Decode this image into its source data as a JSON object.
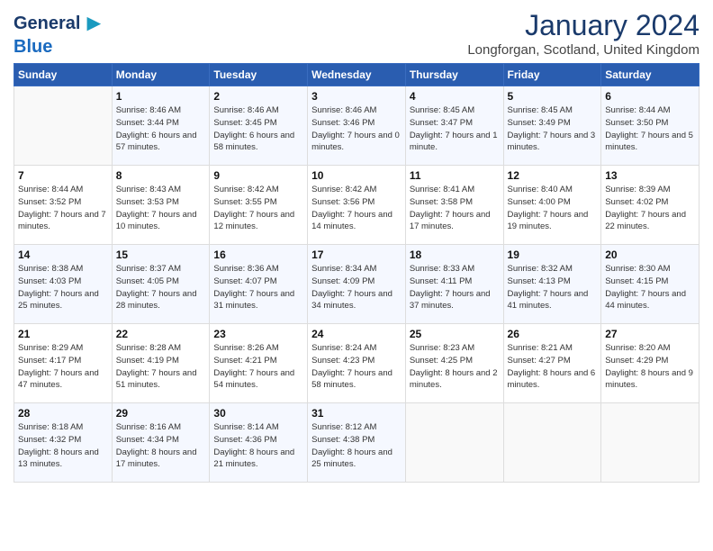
{
  "header": {
    "logo_line1": "General",
    "logo_line2": "Blue",
    "month": "January 2024",
    "location": "Longforgan, Scotland, United Kingdom"
  },
  "days_of_week": [
    "Sunday",
    "Monday",
    "Tuesday",
    "Wednesday",
    "Thursday",
    "Friday",
    "Saturday"
  ],
  "weeks": [
    [
      {
        "day": "",
        "sunrise": "",
        "sunset": "",
        "daylight": ""
      },
      {
        "day": "1",
        "sunrise": "Sunrise: 8:46 AM",
        "sunset": "Sunset: 3:44 PM",
        "daylight": "Daylight: 6 hours and 57 minutes."
      },
      {
        "day": "2",
        "sunrise": "Sunrise: 8:46 AM",
        "sunset": "Sunset: 3:45 PM",
        "daylight": "Daylight: 6 hours and 58 minutes."
      },
      {
        "day": "3",
        "sunrise": "Sunrise: 8:46 AM",
        "sunset": "Sunset: 3:46 PM",
        "daylight": "Daylight: 7 hours and 0 minutes."
      },
      {
        "day": "4",
        "sunrise": "Sunrise: 8:45 AM",
        "sunset": "Sunset: 3:47 PM",
        "daylight": "Daylight: 7 hours and 1 minute."
      },
      {
        "day": "5",
        "sunrise": "Sunrise: 8:45 AM",
        "sunset": "Sunset: 3:49 PM",
        "daylight": "Daylight: 7 hours and 3 minutes."
      },
      {
        "day": "6",
        "sunrise": "Sunrise: 8:44 AM",
        "sunset": "Sunset: 3:50 PM",
        "daylight": "Daylight: 7 hours and 5 minutes."
      }
    ],
    [
      {
        "day": "7",
        "sunrise": "Sunrise: 8:44 AM",
        "sunset": "Sunset: 3:52 PM",
        "daylight": "Daylight: 7 hours and 7 minutes."
      },
      {
        "day": "8",
        "sunrise": "Sunrise: 8:43 AM",
        "sunset": "Sunset: 3:53 PM",
        "daylight": "Daylight: 7 hours and 10 minutes."
      },
      {
        "day": "9",
        "sunrise": "Sunrise: 8:42 AM",
        "sunset": "Sunset: 3:55 PM",
        "daylight": "Daylight: 7 hours and 12 minutes."
      },
      {
        "day": "10",
        "sunrise": "Sunrise: 8:42 AM",
        "sunset": "Sunset: 3:56 PM",
        "daylight": "Daylight: 7 hours and 14 minutes."
      },
      {
        "day": "11",
        "sunrise": "Sunrise: 8:41 AM",
        "sunset": "Sunset: 3:58 PM",
        "daylight": "Daylight: 7 hours and 17 minutes."
      },
      {
        "day": "12",
        "sunrise": "Sunrise: 8:40 AM",
        "sunset": "Sunset: 4:00 PM",
        "daylight": "Daylight: 7 hours and 19 minutes."
      },
      {
        "day": "13",
        "sunrise": "Sunrise: 8:39 AM",
        "sunset": "Sunset: 4:02 PM",
        "daylight": "Daylight: 7 hours and 22 minutes."
      }
    ],
    [
      {
        "day": "14",
        "sunrise": "Sunrise: 8:38 AM",
        "sunset": "Sunset: 4:03 PM",
        "daylight": "Daylight: 7 hours and 25 minutes."
      },
      {
        "day": "15",
        "sunrise": "Sunrise: 8:37 AM",
        "sunset": "Sunset: 4:05 PM",
        "daylight": "Daylight: 7 hours and 28 minutes."
      },
      {
        "day": "16",
        "sunrise": "Sunrise: 8:36 AM",
        "sunset": "Sunset: 4:07 PM",
        "daylight": "Daylight: 7 hours and 31 minutes."
      },
      {
        "day": "17",
        "sunrise": "Sunrise: 8:34 AM",
        "sunset": "Sunset: 4:09 PM",
        "daylight": "Daylight: 7 hours and 34 minutes."
      },
      {
        "day": "18",
        "sunrise": "Sunrise: 8:33 AM",
        "sunset": "Sunset: 4:11 PM",
        "daylight": "Daylight: 7 hours and 37 minutes."
      },
      {
        "day": "19",
        "sunrise": "Sunrise: 8:32 AM",
        "sunset": "Sunset: 4:13 PM",
        "daylight": "Daylight: 7 hours and 41 minutes."
      },
      {
        "day": "20",
        "sunrise": "Sunrise: 8:30 AM",
        "sunset": "Sunset: 4:15 PM",
        "daylight": "Daylight: 7 hours and 44 minutes."
      }
    ],
    [
      {
        "day": "21",
        "sunrise": "Sunrise: 8:29 AM",
        "sunset": "Sunset: 4:17 PM",
        "daylight": "Daylight: 7 hours and 47 minutes."
      },
      {
        "day": "22",
        "sunrise": "Sunrise: 8:28 AM",
        "sunset": "Sunset: 4:19 PM",
        "daylight": "Daylight: 7 hours and 51 minutes."
      },
      {
        "day": "23",
        "sunrise": "Sunrise: 8:26 AM",
        "sunset": "Sunset: 4:21 PM",
        "daylight": "Daylight: 7 hours and 54 minutes."
      },
      {
        "day": "24",
        "sunrise": "Sunrise: 8:24 AM",
        "sunset": "Sunset: 4:23 PM",
        "daylight": "Daylight: 7 hours and 58 minutes."
      },
      {
        "day": "25",
        "sunrise": "Sunrise: 8:23 AM",
        "sunset": "Sunset: 4:25 PM",
        "daylight": "Daylight: 8 hours and 2 minutes."
      },
      {
        "day": "26",
        "sunrise": "Sunrise: 8:21 AM",
        "sunset": "Sunset: 4:27 PM",
        "daylight": "Daylight: 8 hours and 6 minutes."
      },
      {
        "day": "27",
        "sunrise": "Sunrise: 8:20 AM",
        "sunset": "Sunset: 4:29 PM",
        "daylight": "Daylight: 8 hours and 9 minutes."
      }
    ],
    [
      {
        "day": "28",
        "sunrise": "Sunrise: 8:18 AM",
        "sunset": "Sunset: 4:32 PM",
        "daylight": "Daylight: 8 hours and 13 minutes."
      },
      {
        "day": "29",
        "sunrise": "Sunrise: 8:16 AM",
        "sunset": "Sunset: 4:34 PM",
        "daylight": "Daylight: 8 hours and 17 minutes."
      },
      {
        "day": "30",
        "sunrise": "Sunrise: 8:14 AM",
        "sunset": "Sunset: 4:36 PM",
        "daylight": "Daylight: 8 hours and 21 minutes."
      },
      {
        "day": "31",
        "sunrise": "Sunrise: 8:12 AM",
        "sunset": "Sunset: 4:38 PM",
        "daylight": "Daylight: 8 hours and 25 minutes."
      },
      {
        "day": "",
        "sunrise": "",
        "sunset": "",
        "daylight": ""
      },
      {
        "day": "",
        "sunrise": "",
        "sunset": "",
        "daylight": ""
      },
      {
        "day": "",
        "sunrise": "",
        "sunset": "",
        "daylight": ""
      }
    ]
  ]
}
